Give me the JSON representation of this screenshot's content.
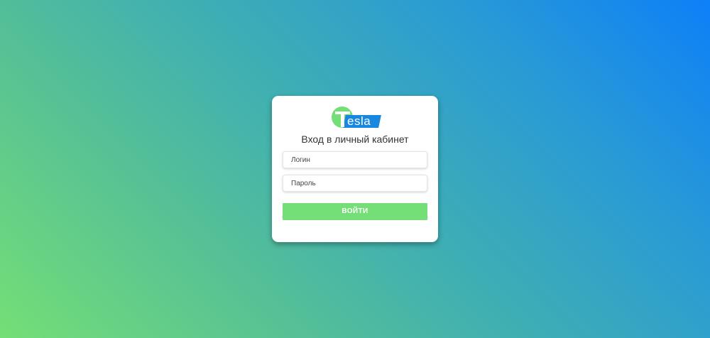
{
  "logo": {
    "letter": "T",
    "text": "esla"
  },
  "login_form": {
    "title": "Вход в личный кабинет",
    "login_placeholder": "Логин",
    "password_placeholder": "Пароль",
    "submit_label": "ВОЙТИ"
  },
  "colors": {
    "brand_green": "#74df76",
    "brand_blue": "#1787e0",
    "gradient_start": "#74df76",
    "gradient_end": "#0d80f8"
  },
  "icons": {
    "logo": "tesla-logo-icon"
  }
}
